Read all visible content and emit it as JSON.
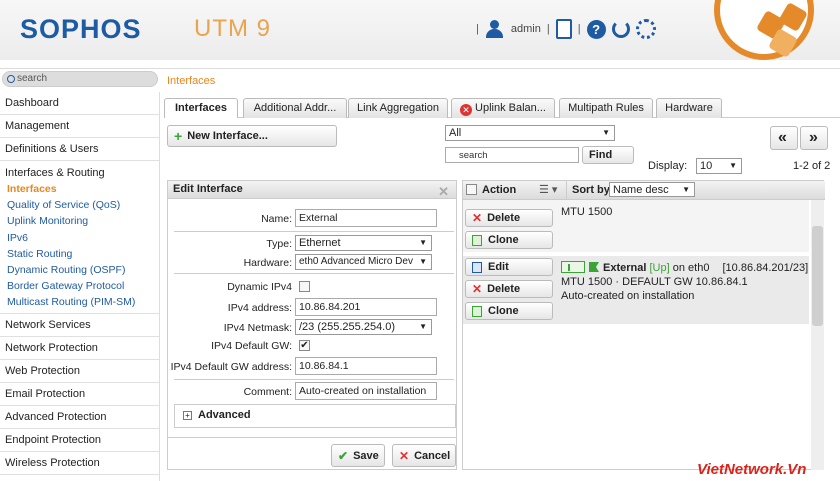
{
  "header": {
    "logo": "SOPHOS",
    "product": "UTM 9",
    "user": "admin"
  },
  "search": {
    "placeholder": "search"
  },
  "breadcrumb": "Interfaces",
  "nav": {
    "items_top": [
      "Dashboard",
      "Management",
      "Definitions & Users"
    ],
    "group": "Interfaces & Routing",
    "subitems": [
      "Interfaces",
      "Quality of Service (QoS)",
      "Uplink Monitoring",
      "IPv6",
      "Static Routing",
      "Dynamic Routing (OSPF)",
      "Border Gateway Protocol",
      "Multicast Routing (PIM-SM)"
    ],
    "items_bottom": [
      "Network Services",
      "Network Protection",
      "Web Protection",
      "Email Protection",
      "Advanced Protection",
      "Endpoint Protection",
      "Wireless Protection"
    ]
  },
  "tabs": [
    "Interfaces",
    "Additional Addr...",
    "Link Aggregation",
    "Uplink Balan...",
    "Multipath Rules",
    "Hardware"
  ],
  "toolbar": {
    "new_interface": "New Interface...",
    "filter_value": "All",
    "search_placeholder": "search",
    "find": "Find",
    "display_label": "Display:",
    "display_value": "10",
    "page_info": "1-2 of 2",
    "prev": "«",
    "next": "»"
  },
  "edit": {
    "title": "Edit Interface",
    "name_label": "Name:",
    "name_value": "External",
    "type_label": "Type:",
    "type_value": "Ethernet",
    "hardware_label": "Hardware:",
    "hardware_value": "eth0 Advanced Micro Dev",
    "dynamic_label": "Dynamic IPv4",
    "addr_label": "IPv4 address:",
    "addr_value": "10.86.84.201",
    "mask_label": "IPv4 Netmask:",
    "mask_value": "/23 (255.255.254.0)",
    "gw_label": "IPv4 Default GW:",
    "gwaddr_label": "IPv4 Default GW address:",
    "gwaddr_value": "10.86.84.1",
    "comment_label": "Comment:",
    "comment_value": "Auto-created on installation",
    "advanced": "Advanced",
    "save": "Save",
    "cancel": "Cancel"
  },
  "list": {
    "action_header": "Action",
    "sortby_label": "Sort by:",
    "sortby_value": "Name desc",
    "row1": {
      "delete": "Delete",
      "clone": "Clone",
      "mtu": "MTU 1500"
    },
    "row2": {
      "edit": "Edit",
      "delete": "Delete",
      "clone": "Clone",
      "name": "External",
      "state": "[Up]",
      "on": "on eth0",
      "ip": "[10.86.84.201/23]",
      "mtu": "MTU 1500 · DEFAULT GW 10.86.84.1",
      "comment": "Auto-created on installation"
    }
  },
  "watermark": "VietNetwork.Vn"
}
